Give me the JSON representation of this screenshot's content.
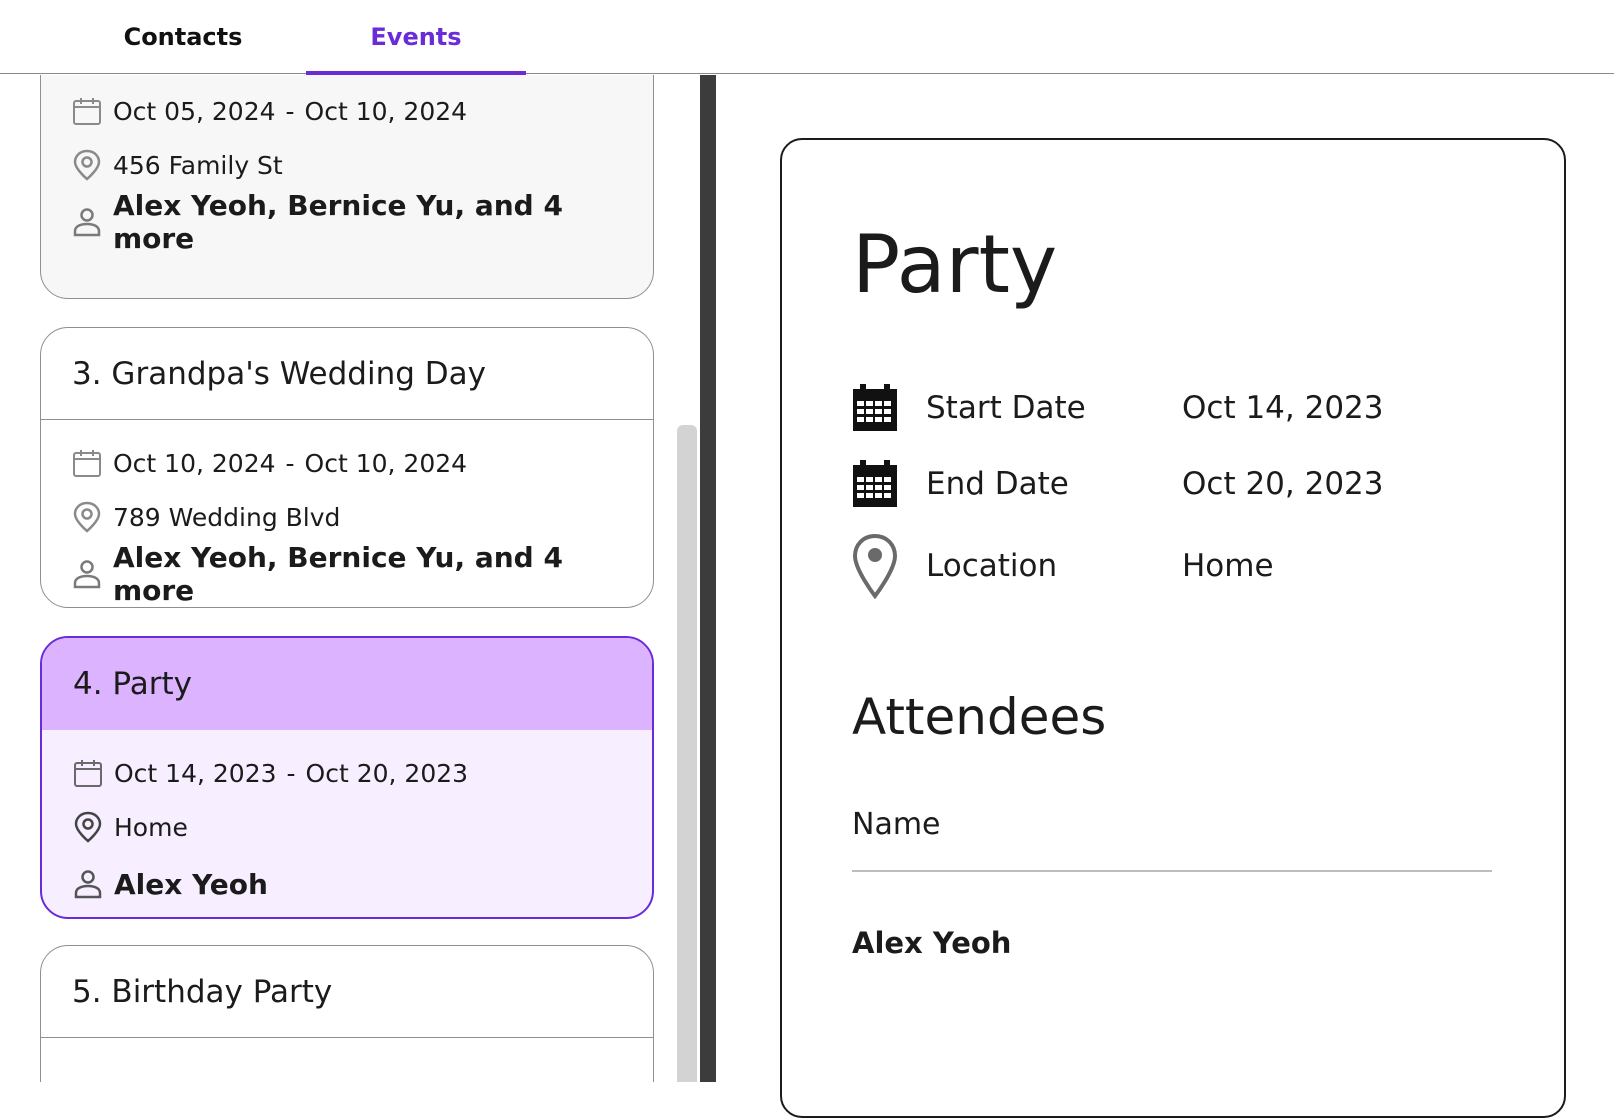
{
  "tabs": [
    {
      "label": "Contacts",
      "active": false
    },
    {
      "label": "Events",
      "active": true
    }
  ],
  "colors": {
    "accent": "#6a2bd9",
    "selected_header": "#dbb3ff",
    "selected_body": "#f7efff"
  },
  "events": [
    {
      "title": "",
      "start": "Oct 05, 2024",
      "end": "Oct 10, 2024",
      "location": "456 Family St",
      "attendees": "Alex Yeoh, Bernice Yu, and 4 more"
    },
    {
      "title": "3. Grandpa's Wedding Day",
      "start": "Oct 10, 2024",
      "end": "Oct 10, 2024",
      "location": "789 Wedding Blvd",
      "attendees": "Alex Yeoh, Bernice Yu, and 4 more"
    },
    {
      "title": "4. Party",
      "start": "Oct 14, 2023",
      "end": "Oct 20, 2023",
      "location": "Home",
      "attendees": "Alex Yeoh",
      "selected": true
    },
    {
      "title": "5. Birthday Party"
    }
  ],
  "date_separator": "-",
  "detail": {
    "title": "Party",
    "start_label": "Start Date",
    "start_value": "Oct 14, 2023",
    "end_label": "End Date",
    "end_value": "Oct 20, 2023",
    "location_label": "Location",
    "location_value": "Home",
    "attendees_title": "Attendees",
    "column_name": "Name",
    "attendees": [
      "Alex Yeoh"
    ]
  }
}
